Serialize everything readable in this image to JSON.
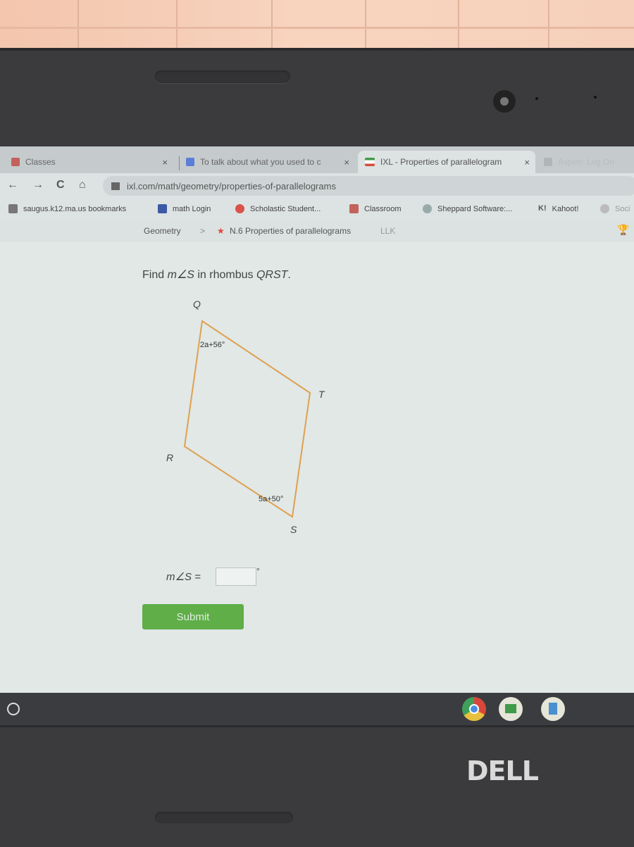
{
  "tabs": [
    {
      "title": "Classes",
      "active": false,
      "close": "×"
    },
    {
      "title": "To talk about what you used to c",
      "active": false,
      "close": "×"
    },
    {
      "title": "IXL - Properties of parallelogram",
      "active": true,
      "close": "×"
    },
    {
      "title": "Aspen: Log On",
      "active": false
    }
  ],
  "nav": {
    "back": "←",
    "forward": "→",
    "reload": "C",
    "home": "⌂",
    "url": "ixl.com/math/geometry/properties-of-parallelograms"
  },
  "bookmarks": [
    {
      "label": "saugus.k12.ma.us bookmarks"
    },
    {
      "label": "math Login"
    },
    {
      "label": "Scholastic Student..."
    },
    {
      "label": "Classroom"
    },
    {
      "label": "Sheppard Software:..."
    },
    {
      "label": "Kahoot!"
    },
    {
      "label": "Soci"
    }
  ],
  "breadcrumb": {
    "subject": "Geometry",
    "separator": ">",
    "skill": "N.6 Properties of parallelograms",
    "code": "LLK"
  },
  "question": {
    "prefix": "Find ",
    "angle": "m∠S",
    "middle": " in rhombus ",
    "shape": "QRST",
    "suffix": "."
  },
  "figure": {
    "vertices": {
      "Q": "Q",
      "R": "R",
      "S": "S",
      "T": "T"
    },
    "angle_Q": "2a+56°",
    "angle_S": "5a+50°",
    "stroke_color": "#e0a050"
  },
  "answer": {
    "label": "m∠S =",
    "value": "",
    "unit": "°"
  },
  "submit_label": "Submit",
  "colors": {
    "submit": "#5fae48",
    "star": "#e0463a"
  },
  "brand": "DELL"
}
